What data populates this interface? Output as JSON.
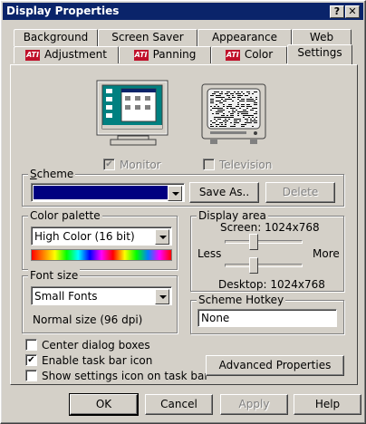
{
  "window": {
    "title": "Display Properties",
    "help_button": "?",
    "close_button": "✕"
  },
  "tabs_back": [
    "Background",
    "Screen Saver",
    "Appearance",
    "Web"
  ],
  "tabs_front": [
    "Adjustment",
    "Panning",
    "Color",
    "Settings"
  ],
  "ati_logo": "ATI",
  "monitors": {
    "monitor_label": "Monitor",
    "monitor_checked": true,
    "television_label": "Television",
    "television_checked": false
  },
  "scheme": {
    "label": "Scheme",
    "value": "",
    "save_as": "Save As..",
    "delete": "Delete"
  },
  "color_palette": {
    "label": "Color palette",
    "value": "High Color (16 bit)"
  },
  "display_area": {
    "label": "Display area",
    "screen": "Screen: 1024x768",
    "less": "Less",
    "more": "More",
    "desktop": "Desktop: 1024x768"
  },
  "font_size": {
    "label": "Font size",
    "value": "Small Fonts",
    "note": "Normal size (96 dpi)"
  },
  "scheme_hotkey": {
    "label": "Scheme Hotkey",
    "value": "None"
  },
  "options": [
    {
      "label": "Center dialog boxes",
      "checked": false
    },
    {
      "label": "Enable task bar icon",
      "checked": true
    },
    {
      "label": "Show settings icon on task bar",
      "checked": false
    }
  ],
  "advanced_button": "Advanced Properties",
  "dialog_buttons": {
    "ok": "OK",
    "cancel": "Cancel",
    "apply": "Apply",
    "help": "Help"
  },
  "colors": {
    "title_bar": "#0a246a",
    "face": "#d4d0c8",
    "scheme_fill": "#000080",
    "selection": "#0a246a"
  }
}
